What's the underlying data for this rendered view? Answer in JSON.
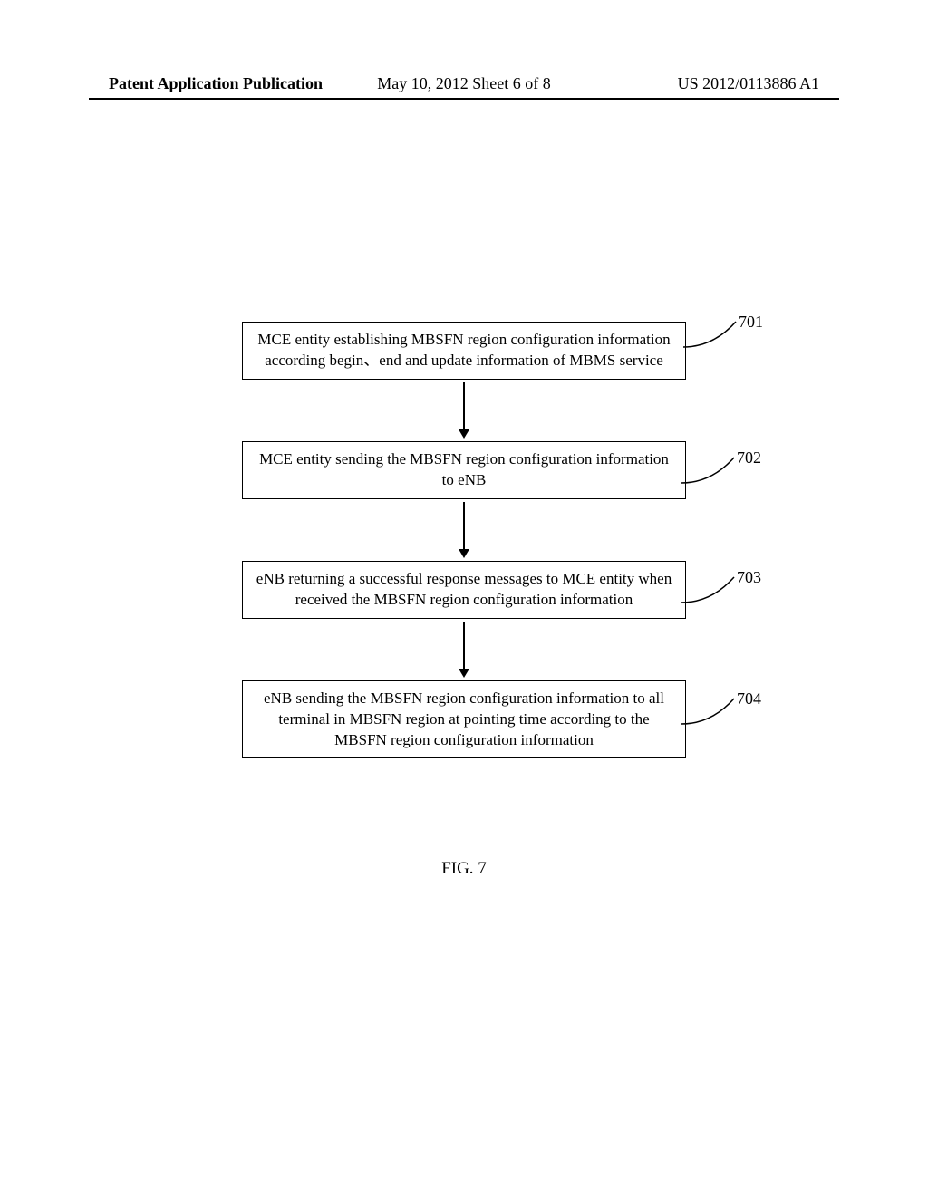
{
  "header": {
    "left": "Patent Application Publication",
    "center": "May 10, 2012  Sheet 6 of 8",
    "right": "US 2012/0113886 A1"
  },
  "labels": {
    "l701": "701",
    "l702": "702",
    "l703": "703",
    "l704": "704"
  },
  "boxes": {
    "b1": "MCE entity establishing MBSFN region configuration information according begin、end and update information of MBMS service",
    "b2": "MCE entity sending the MBSFN region configuration information to eNB",
    "b3": "eNB returning a successful response messages to MCE entity when received the MBSFN region configuration information",
    "b4": "eNB sending the MBSFN region configuration information to all terminal in MBSFN region at pointing time according to the MBSFN region configuration information"
  },
  "caption": "FIG. 7"
}
